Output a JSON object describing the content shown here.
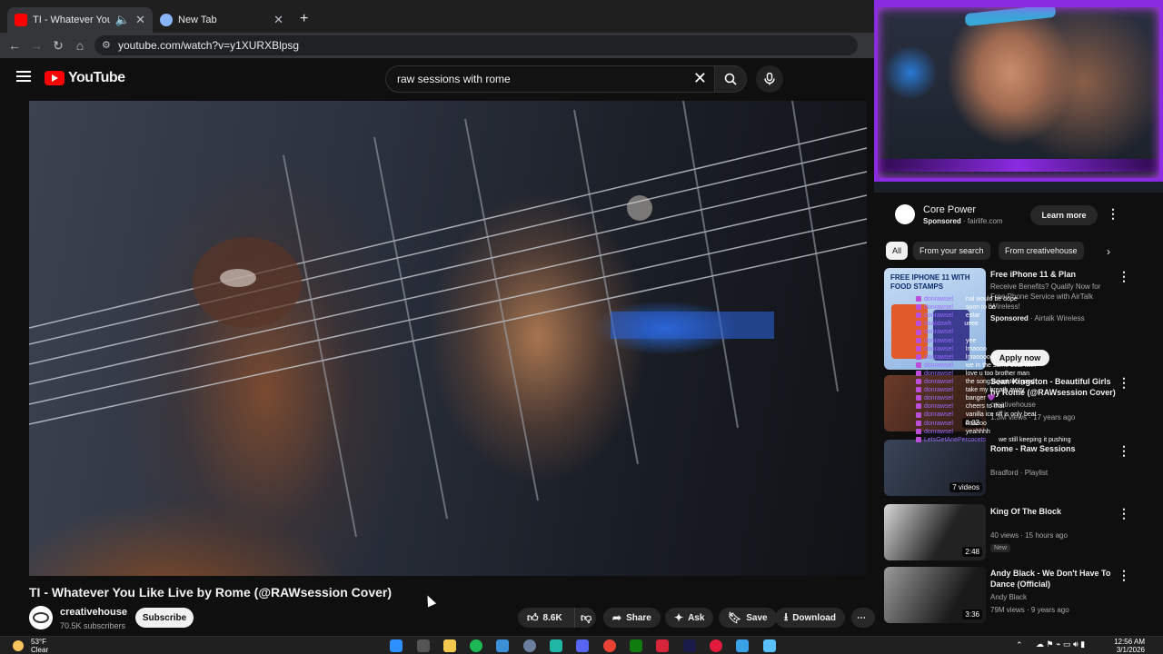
{
  "browser": {
    "tabs": [
      {
        "title": "TI - Whatever You Like Live",
        "active": true
      },
      {
        "title": "New Tab",
        "active": false
      }
    ],
    "url": "youtube.com/watch?v=y1XURXBlpsg"
  },
  "youtube": {
    "logo_text": "YouTube",
    "search_query": "raw sessions with rome"
  },
  "video": {
    "title": "TI - Whatever You Like Live by Rome (@RAWsession Cover)",
    "channel": "creativehouse",
    "subscribers": "70.5K subscribers",
    "subscribe_label": "Subscribe",
    "likes": "8.6K",
    "share_label": "Share",
    "ask_label": "Ask",
    "save_label": "Save",
    "download_label": "Download"
  },
  "sidebar": {
    "ad": {
      "name": "Core Power",
      "sponsored": "Sponsored",
      "domain": "fairlife.com",
      "cta": "Learn more"
    },
    "chips": [
      "All",
      "From your search",
      "From creativehouse"
    ],
    "items": [
      {
        "title": "Free iPhone 11 & Plan",
        "desc": "Receive Benefits? Qualify Now for Free Phone Service with AirTalk Wireless!",
        "sponsored": "Sponsored",
        "advertiser": "Airtalk Wireless",
        "cta": "Apply now",
        "thumb_text": "FREE IPHONE 11 WITH FOOD STAMPS"
      },
      {
        "title": "Sean Kingston - Beautiful Girls by Rome (@RAWsession Cover)",
        "channel": "creativehouse",
        "meta": "1.3M views · 17 years ago",
        "duration": "4:02"
      },
      {
        "title": "Rome - Raw Sessions",
        "channel": "Bradford · Playlist",
        "meta": "",
        "duration": "7 videos"
      },
      {
        "title": "King Of The Block",
        "channel": "",
        "meta": "40 views · 15 hours ago",
        "badge": "New",
        "duration": "2:48"
      },
      {
        "title": "Andy Black - We Don't Have To Dance (Official)",
        "channel": "Andy Black",
        "meta": "79M views · 9 years ago",
        "duration": "3:36"
      }
    ]
  },
  "chat": [
    {
      "user": "donrawsel",
      "msg": "nal would be dope"
    },
    {
      "user": "donrawsel",
      "msg": "soon to be"
    },
    {
      "user": "donrawsel",
      "msg": "estar"
    },
    {
      "user": "ItsAldowh",
      "msg": "ueee"
    },
    {
      "user": "donrawsel",
      "msg": ""
    },
    {
      "user": "donrawsel",
      "msg": "yee"
    },
    {
      "user": "donrawsel",
      "msg": "lmaooo"
    },
    {
      "user": "donrawsel",
      "msg": "lmaoooooo"
    },
    {
      "user": "donrawsel",
      "msg": "we in the same boat twin"
    },
    {
      "user": "donrawsel",
      "msg": "love u too brother man"
    },
    {
      "user": "donrawsel",
      "msg": "the song is just too good"
    },
    {
      "user": "donrawsel",
      "msg": "take my breath away"
    },
    {
      "user": "donrawsel",
      "msg": "banger 💜"
    },
    {
      "user": "donrawsel",
      "msg": "cheers to that"
    },
    {
      "user": "donrawsel",
      "msg": "vanilla ice riff is only beat"
    },
    {
      "user": "donrawsel",
      "msg": "lmaooo"
    },
    {
      "user": "donrawsel",
      "msg": "yeahhhh"
    },
    {
      "user": "LetsGetAnePercocets",
      "msg": "we still keeping it pushing"
    }
  ],
  "taskbar": {
    "temp": "53°F",
    "weather": "Clear",
    "time": "12:56 AM",
    "date": "3/1/2026"
  },
  "colors": {
    "youtube_red": "#ff0000",
    "overlay_purple": "#8a2be2",
    "chat_user": "#9b6bff"
  }
}
